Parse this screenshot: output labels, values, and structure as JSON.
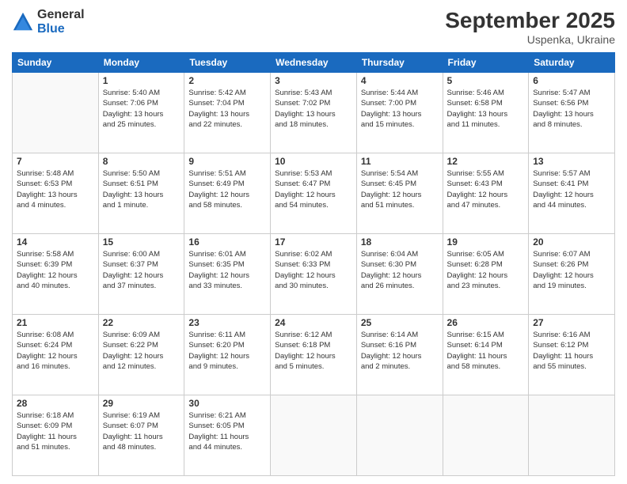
{
  "logo": {
    "general": "General",
    "blue": "Blue"
  },
  "title": "September 2025",
  "location": "Uspenka, Ukraine",
  "days_of_week": [
    "Sunday",
    "Monday",
    "Tuesday",
    "Wednesday",
    "Thursday",
    "Friday",
    "Saturday"
  ],
  "weeks": [
    [
      {
        "day": "",
        "info": ""
      },
      {
        "day": "1",
        "info": "Sunrise: 5:40 AM\nSunset: 7:06 PM\nDaylight: 13 hours\nand 25 minutes."
      },
      {
        "day": "2",
        "info": "Sunrise: 5:42 AM\nSunset: 7:04 PM\nDaylight: 13 hours\nand 22 minutes."
      },
      {
        "day": "3",
        "info": "Sunrise: 5:43 AM\nSunset: 7:02 PM\nDaylight: 13 hours\nand 18 minutes."
      },
      {
        "day": "4",
        "info": "Sunrise: 5:44 AM\nSunset: 7:00 PM\nDaylight: 13 hours\nand 15 minutes."
      },
      {
        "day": "5",
        "info": "Sunrise: 5:46 AM\nSunset: 6:58 PM\nDaylight: 13 hours\nand 11 minutes."
      },
      {
        "day": "6",
        "info": "Sunrise: 5:47 AM\nSunset: 6:56 PM\nDaylight: 13 hours\nand 8 minutes."
      }
    ],
    [
      {
        "day": "7",
        "info": "Sunrise: 5:48 AM\nSunset: 6:53 PM\nDaylight: 13 hours\nand 4 minutes."
      },
      {
        "day": "8",
        "info": "Sunrise: 5:50 AM\nSunset: 6:51 PM\nDaylight: 13 hours\nand 1 minute."
      },
      {
        "day": "9",
        "info": "Sunrise: 5:51 AM\nSunset: 6:49 PM\nDaylight: 12 hours\nand 58 minutes."
      },
      {
        "day": "10",
        "info": "Sunrise: 5:53 AM\nSunset: 6:47 PM\nDaylight: 12 hours\nand 54 minutes."
      },
      {
        "day": "11",
        "info": "Sunrise: 5:54 AM\nSunset: 6:45 PM\nDaylight: 12 hours\nand 51 minutes."
      },
      {
        "day": "12",
        "info": "Sunrise: 5:55 AM\nSunset: 6:43 PM\nDaylight: 12 hours\nand 47 minutes."
      },
      {
        "day": "13",
        "info": "Sunrise: 5:57 AM\nSunset: 6:41 PM\nDaylight: 12 hours\nand 44 minutes."
      }
    ],
    [
      {
        "day": "14",
        "info": "Sunrise: 5:58 AM\nSunset: 6:39 PM\nDaylight: 12 hours\nand 40 minutes."
      },
      {
        "day": "15",
        "info": "Sunrise: 6:00 AM\nSunset: 6:37 PM\nDaylight: 12 hours\nand 37 minutes."
      },
      {
        "day": "16",
        "info": "Sunrise: 6:01 AM\nSunset: 6:35 PM\nDaylight: 12 hours\nand 33 minutes."
      },
      {
        "day": "17",
        "info": "Sunrise: 6:02 AM\nSunset: 6:33 PM\nDaylight: 12 hours\nand 30 minutes."
      },
      {
        "day": "18",
        "info": "Sunrise: 6:04 AM\nSunset: 6:30 PM\nDaylight: 12 hours\nand 26 minutes."
      },
      {
        "day": "19",
        "info": "Sunrise: 6:05 AM\nSunset: 6:28 PM\nDaylight: 12 hours\nand 23 minutes."
      },
      {
        "day": "20",
        "info": "Sunrise: 6:07 AM\nSunset: 6:26 PM\nDaylight: 12 hours\nand 19 minutes."
      }
    ],
    [
      {
        "day": "21",
        "info": "Sunrise: 6:08 AM\nSunset: 6:24 PM\nDaylight: 12 hours\nand 16 minutes."
      },
      {
        "day": "22",
        "info": "Sunrise: 6:09 AM\nSunset: 6:22 PM\nDaylight: 12 hours\nand 12 minutes."
      },
      {
        "day": "23",
        "info": "Sunrise: 6:11 AM\nSunset: 6:20 PM\nDaylight: 12 hours\nand 9 minutes."
      },
      {
        "day": "24",
        "info": "Sunrise: 6:12 AM\nSunset: 6:18 PM\nDaylight: 12 hours\nand 5 minutes."
      },
      {
        "day": "25",
        "info": "Sunrise: 6:14 AM\nSunset: 6:16 PM\nDaylight: 12 hours\nand 2 minutes."
      },
      {
        "day": "26",
        "info": "Sunrise: 6:15 AM\nSunset: 6:14 PM\nDaylight: 11 hours\nand 58 minutes."
      },
      {
        "day": "27",
        "info": "Sunrise: 6:16 AM\nSunset: 6:12 PM\nDaylight: 11 hours\nand 55 minutes."
      }
    ],
    [
      {
        "day": "28",
        "info": "Sunrise: 6:18 AM\nSunset: 6:09 PM\nDaylight: 11 hours\nand 51 minutes."
      },
      {
        "day": "29",
        "info": "Sunrise: 6:19 AM\nSunset: 6:07 PM\nDaylight: 11 hours\nand 48 minutes."
      },
      {
        "day": "30",
        "info": "Sunrise: 6:21 AM\nSunset: 6:05 PM\nDaylight: 11 hours\nand 44 minutes."
      },
      {
        "day": "",
        "info": ""
      },
      {
        "day": "",
        "info": ""
      },
      {
        "day": "",
        "info": ""
      },
      {
        "day": "",
        "info": ""
      }
    ]
  ]
}
